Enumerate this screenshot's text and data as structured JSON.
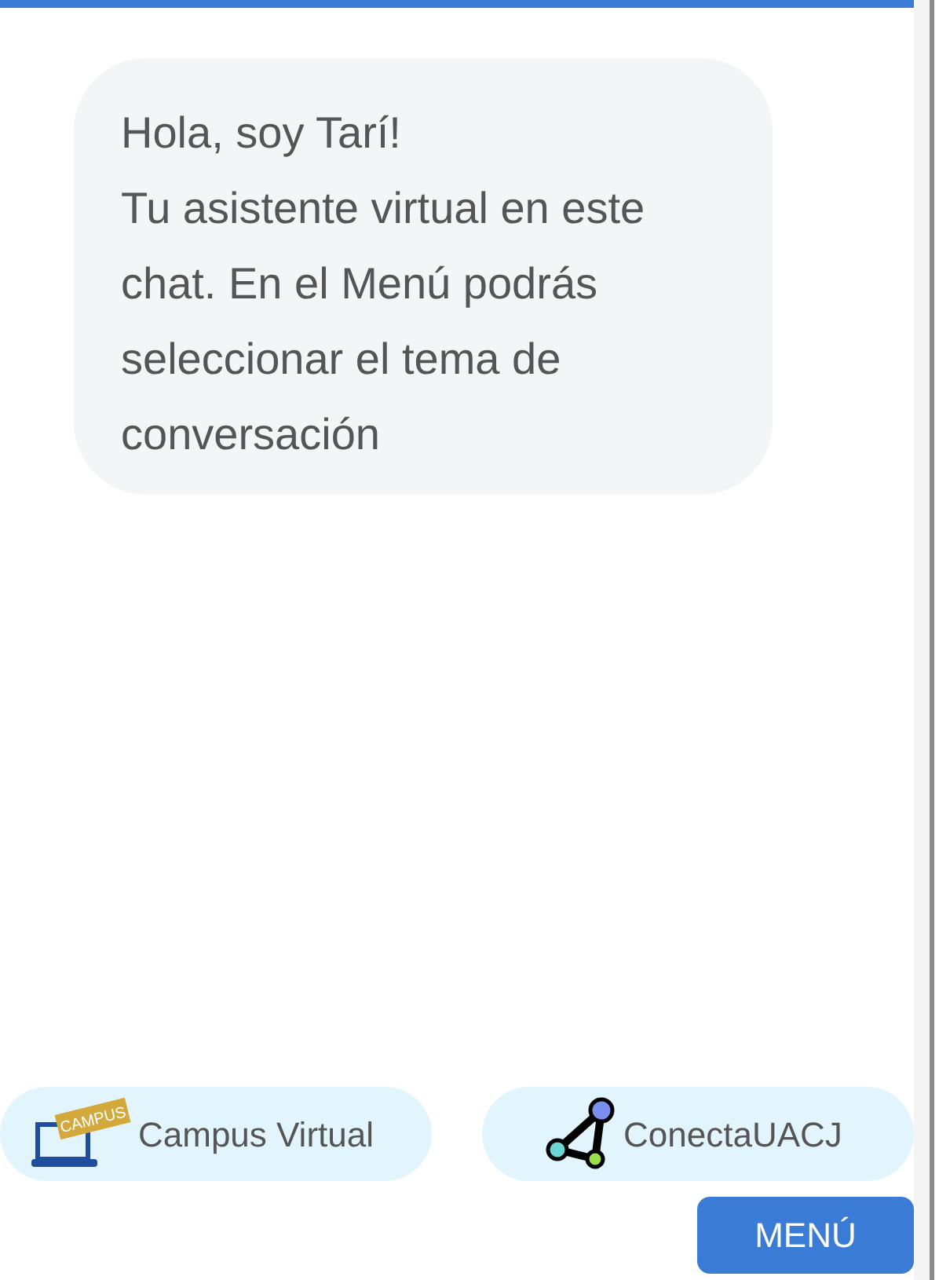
{
  "message": {
    "lines": [
      "Hola, soy Tarí!",
      "Tu asistente virtual en este chat. En el Menú podrás seleccionar el tema de conversación"
    ]
  },
  "shortcuts": [
    {
      "kind": "campus",
      "label": "Campus Virtual",
      "icon_label": "CAMPUS"
    },
    {
      "kind": "network",
      "label": "ConectaUACJ"
    }
  ],
  "menu_button": "MENÚ"
}
